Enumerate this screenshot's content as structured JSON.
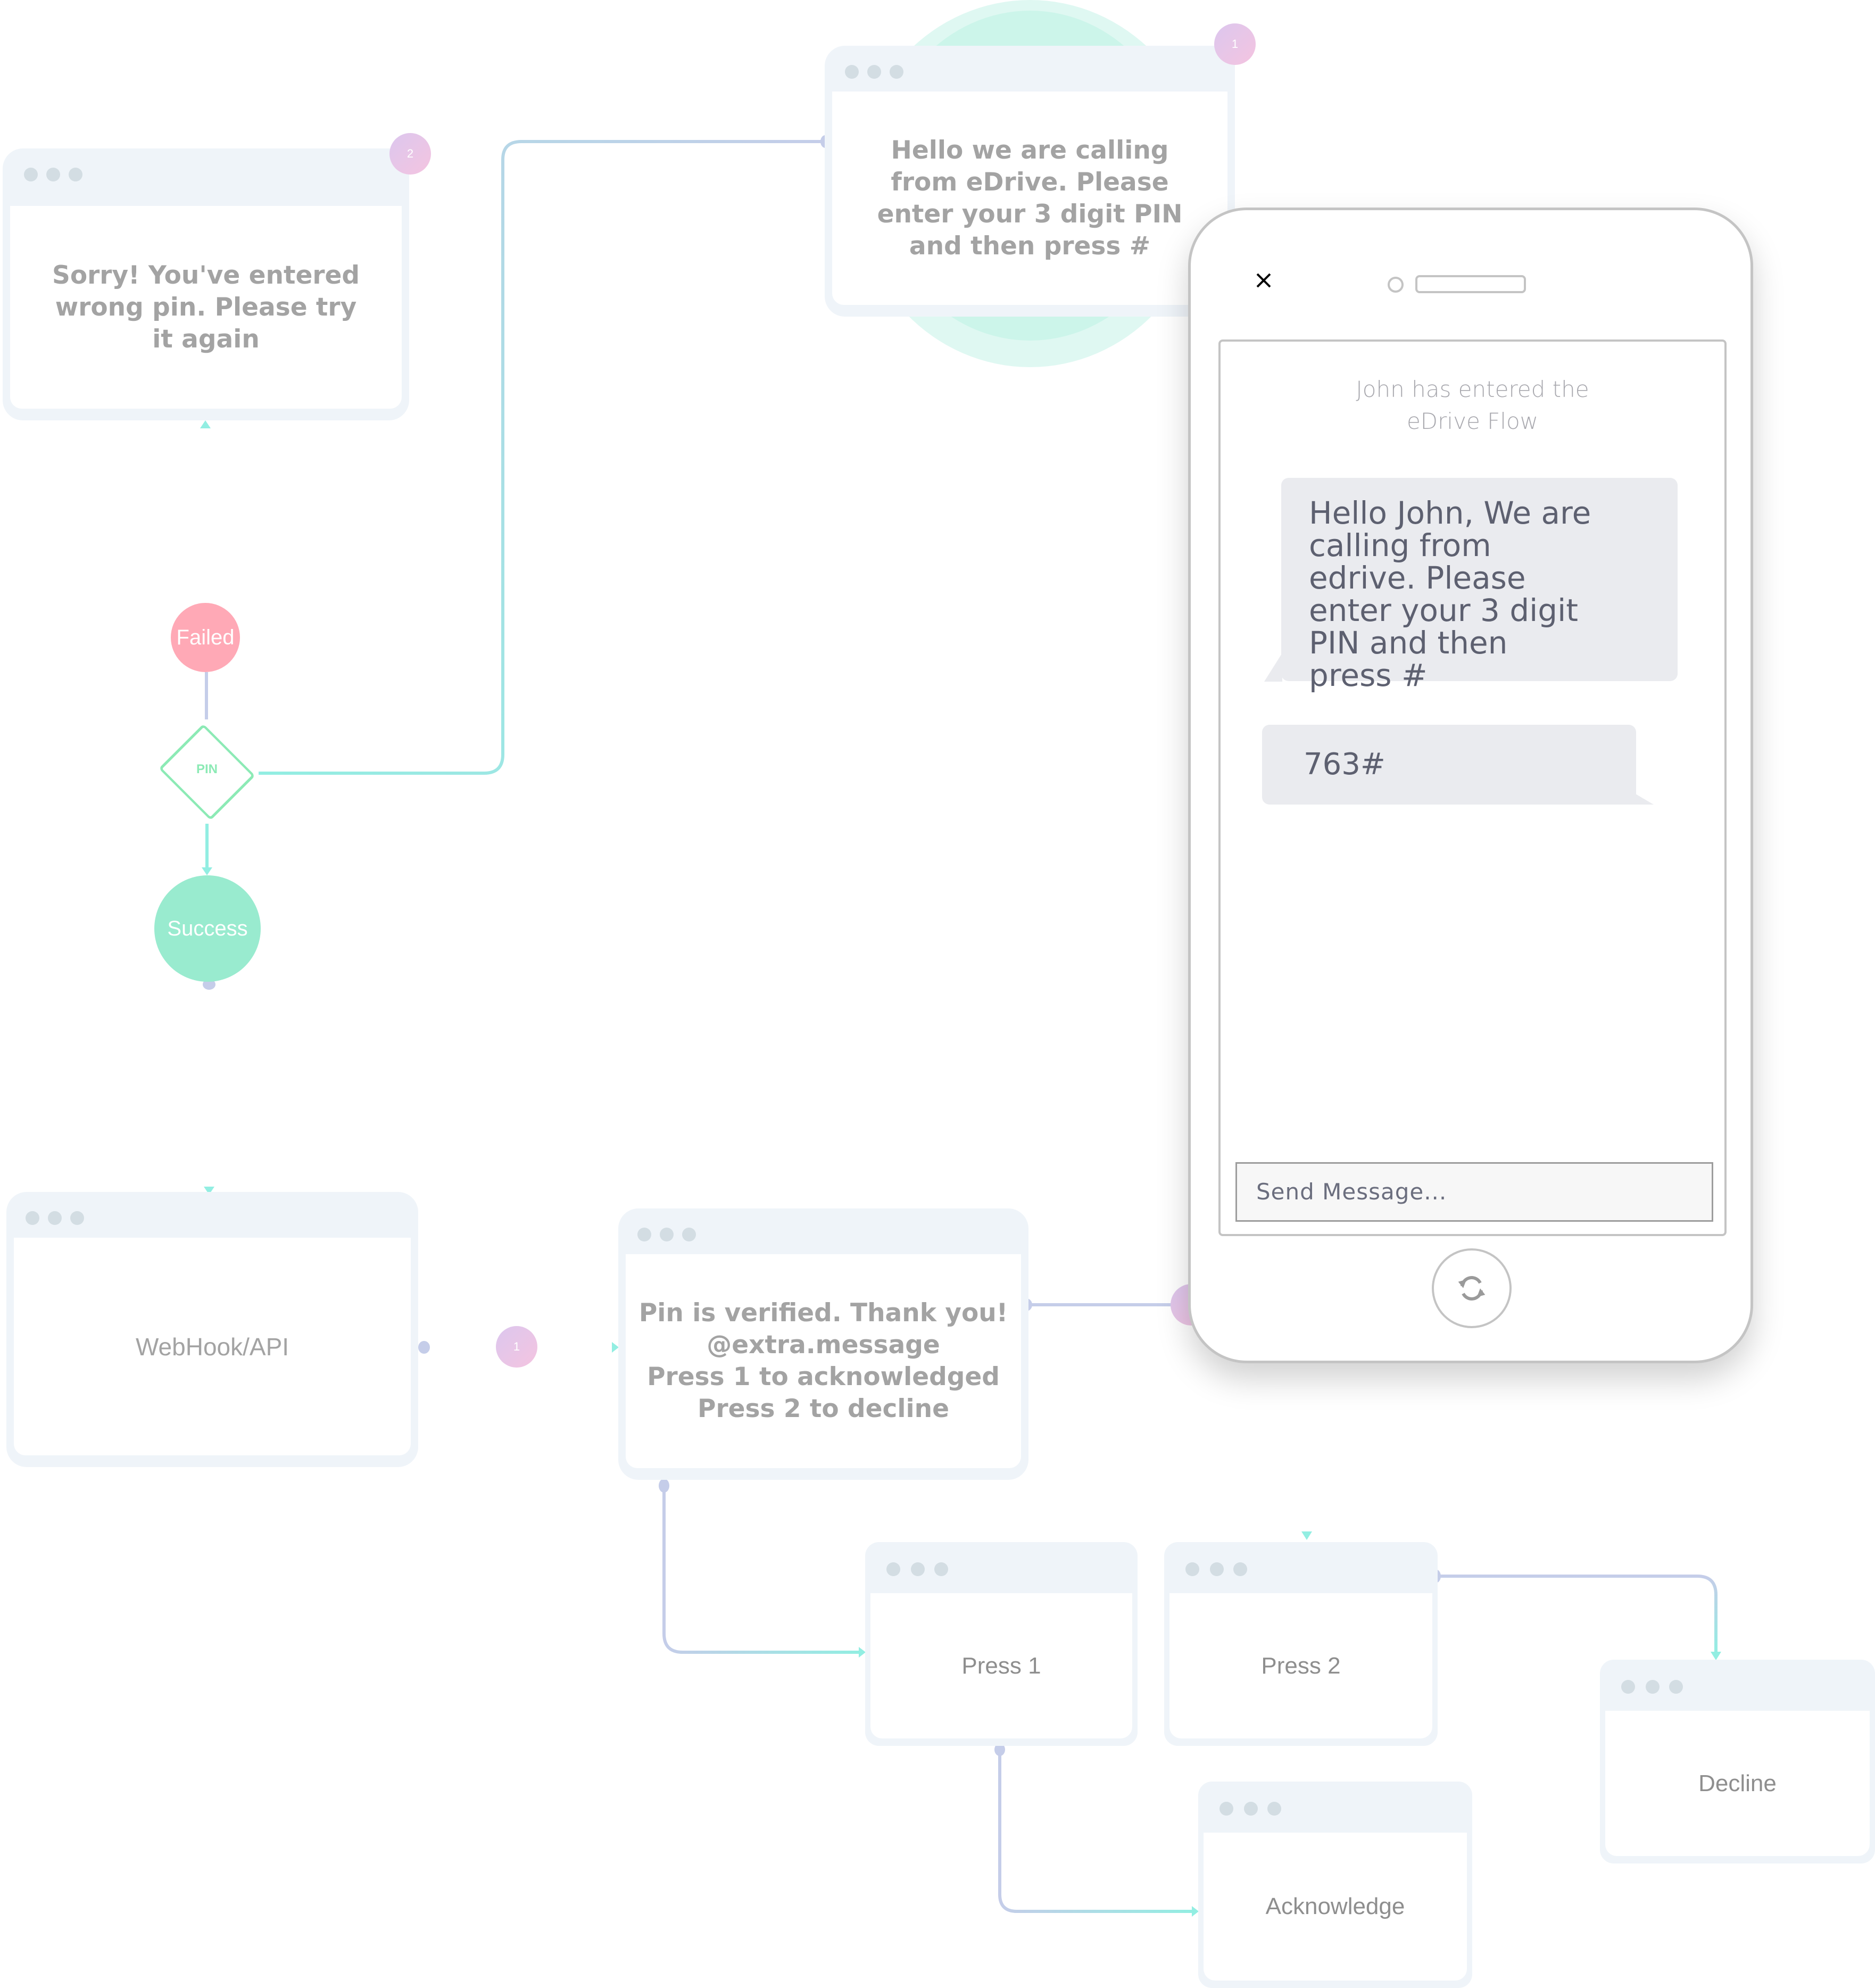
{
  "colors": {
    "window_frame": "#eff4f9",
    "window_dot": "#d3dde3",
    "node_text": "#a3a3a3",
    "connector_lavender": "#c5cde9",
    "connector_teal": "#92eee2",
    "failed": "#ffa9b6",
    "success": "#99ebcf",
    "pin_decision": "#8ceab5",
    "badge_gradient": [
      "#dcc7ee",
      "#f4c4e0"
    ],
    "halo": "#c9f6ea"
  },
  "nodes": {
    "wrong_pin": {
      "text": "Sorry! You've entered wrong pin. Please try it again",
      "badge": "2"
    },
    "greeting": {
      "text": "Hello we are calling from eDrive. Please enter your 3 digit PIN and then press #",
      "badge": "1"
    },
    "failed": {
      "label": "Failed"
    },
    "pin": {
      "label": "PIN"
    },
    "success": {
      "label": "Success"
    },
    "webhook": {
      "text": "WebHook/API",
      "badge": "1"
    },
    "verified": {
      "lines": [
        "Pin is verified. Thank you!",
        "@extra.message",
        "Press 1 to acknowledged",
        "Press 2 to decline"
      ]
    },
    "press1": {
      "text": "Press 1"
    },
    "press2": {
      "text": "Press 2"
    },
    "decline": {
      "text": "Decline"
    },
    "acknowledge": {
      "text": "Acknowledge"
    }
  },
  "phone": {
    "close_icon": "close-icon",
    "system_message": "John has entered the eDrive Flow",
    "messages": [
      {
        "from": "bot",
        "text": "Hello John, We are calling from edrive. Please enter your 3 digit PIN and then press #"
      },
      {
        "from": "user",
        "text": "763#"
      }
    ],
    "input_placeholder": "Send Message...",
    "refresh_icon": "refresh-icon"
  }
}
